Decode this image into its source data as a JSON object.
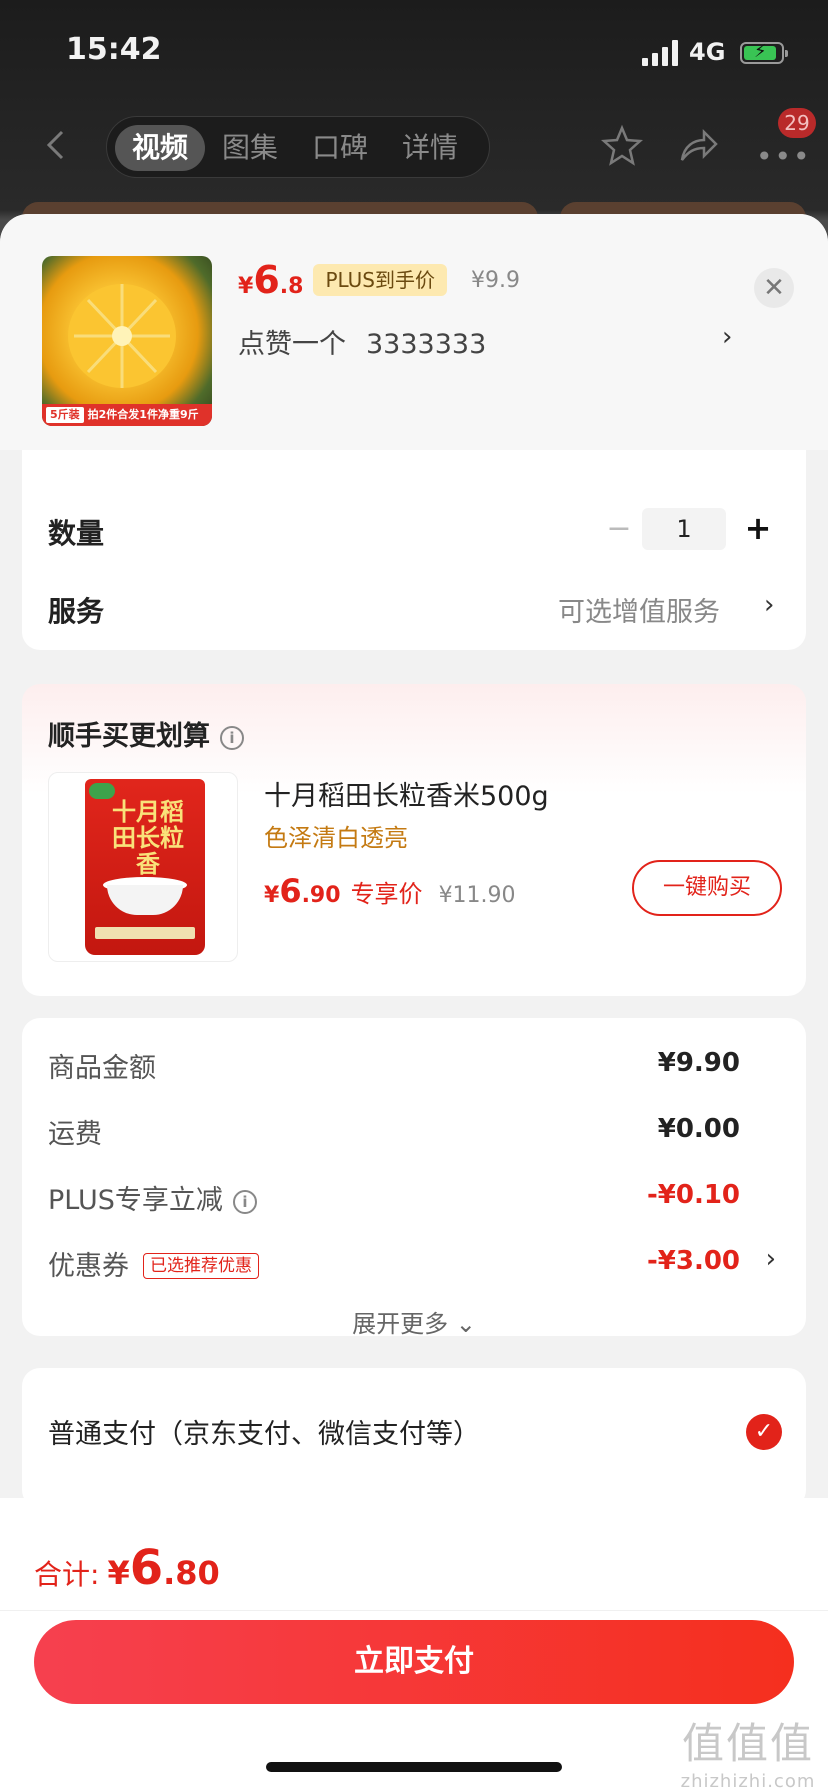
{
  "status_bar": {
    "time": "15:42",
    "network": "4G",
    "battery_color": "#39c454"
  },
  "top_nav": {
    "tabs": [
      {
        "label": "视频",
        "active": true
      },
      {
        "label": "图集",
        "active": false
      },
      {
        "label": "口碑",
        "active": false
      },
      {
        "label": "详情",
        "active": false
      }
    ],
    "message_badge": "29"
  },
  "product": {
    "image_tag": "5斤装",
    "image_note": "拍2件合发1件净重9斤",
    "price_symbol": "¥",
    "price_int": "6",
    "price_dec": ".8",
    "plus_tag": "PLUS到手价",
    "original_price": "¥9.9",
    "selection_label": "点赞一个",
    "selection_value": "3333333"
  },
  "quantity": {
    "label": "数量",
    "value": "1",
    "minus": "−",
    "plus": "+"
  },
  "service": {
    "label": "服务",
    "hint": "可选增值服务"
  },
  "addon": {
    "title": "顺手买更划算",
    "product_name": "十月稻田长粒香米500g",
    "subtitle": "色泽清白透亮",
    "package_text": "十月稻田长粒香",
    "price_symbol": "¥",
    "price_int": "6",
    "price_dec": ".90",
    "exclusive_label": "专享价",
    "original_price": "¥11.90",
    "buy_button": "一键购买"
  },
  "summary": {
    "rows": [
      {
        "label": "商品金额",
        "value": "¥9.90"
      },
      {
        "label": "运费",
        "value": "¥0.00"
      },
      {
        "label": "PLUS专享立减",
        "value": "-¥0.10"
      },
      {
        "label": "优惠券",
        "tag": "已选推荐优惠",
        "value": "-¥3.00"
      }
    ],
    "expand": "展开更多"
  },
  "payment": {
    "option": "普通支付（京东支付、微信支付等）",
    "selected": true
  },
  "bottom": {
    "total_label": "合计:",
    "total_symbol": "¥",
    "total_int": "6",
    "total_dec": ".80",
    "pay_button": "立即支付"
  },
  "watermark": {
    "big": "值值值",
    "small": "zhizhizhi.com"
  },
  "colors": {
    "accent": "#e2231a",
    "gold": "#c47a12",
    "plus_tag_bg": "#fde9b0"
  }
}
